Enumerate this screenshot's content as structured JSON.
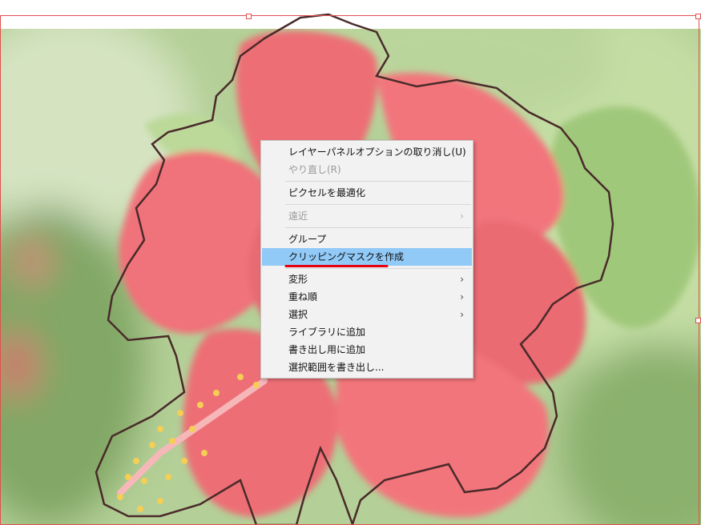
{
  "context_menu": {
    "items": [
      {
        "label": "レイヤーパネルオプションの取り消し(U)",
        "enabled": true,
        "submenu": false
      },
      {
        "label": "やり直し(R)",
        "enabled": false,
        "submenu": false
      },
      {
        "label": "ピクセルを最適化",
        "enabled": true,
        "submenu": false
      },
      {
        "label": "遠近",
        "enabled": false,
        "submenu": true
      },
      {
        "label": "グループ",
        "enabled": true,
        "submenu": false
      },
      {
        "label": "クリッピングマスクを作成",
        "enabled": true,
        "submenu": false,
        "highlighted": true
      },
      {
        "label": "変形",
        "enabled": true,
        "submenu": true
      },
      {
        "label": "重ね順",
        "enabled": true,
        "submenu": true
      },
      {
        "label": "選択",
        "enabled": true,
        "submenu": true
      },
      {
        "label": "ライブラリに追加",
        "enabled": true,
        "submenu": false
      },
      {
        "label": "書き出し用に追加",
        "enabled": true,
        "submenu": false
      },
      {
        "label": "選択範囲を書き出し...",
        "enabled": true,
        "submenu": false
      }
    ],
    "submenu_arrow": "›"
  },
  "icons": {
    "submenu": "chevron-right-icon"
  },
  "colors": {
    "highlight": "#91c9f7",
    "selection_box": "#e0504e",
    "annotation_underline": "#e60012",
    "path_outline": "#4a2a2a"
  }
}
